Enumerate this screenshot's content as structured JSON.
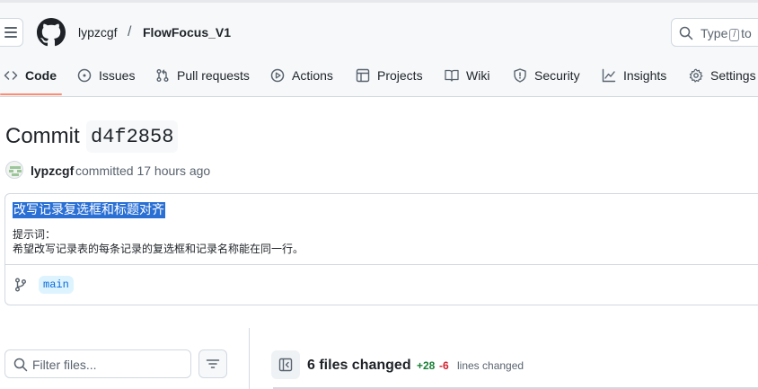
{
  "header": {
    "owner": "lypzcgf",
    "separator": "/",
    "repo": "FlowFocus_V1",
    "search_prefix": "Type",
    "search_key": "/",
    "search_suffix": "to"
  },
  "tabs": [
    {
      "label": "Code",
      "icon": "code-icon",
      "active": true
    },
    {
      "label": "Issues",
      "icon": "issue-opened-icon"
    },
    {
      "label": "Pull requests",
      "icon": "git-pull-request-icon"
    },
    {
      "label": "Actions",
      "icon": "play-icon"
    },
    {
      "label": "Projects",
      "icon": "table-icon"
    },
    {
      "label": "Wiki",
      "icon": "book-icon"
    },
    {
      "label": "Security",
      "icon": "shield-icon"
    },
    {
      "label": "Insights",
      "icon": "graph-icon"
    },
    {
      "label": "Settings",
      "icon": "gear-icon"
    }
  ],
  "commit": {
    "heading": "Commit",
    "sha": "d4f2858",
    "author": "lypzcgf",
    "meta": "committed 17 hours ago",
    "title": "改写记录复选框和标题对齐",
    "body_line1": "提示词：",
    "body_line2": "希望改写记录表的每条记录的复选框和记录名称能在同一行。",
    "branch": "main"
  },
  "files": {
    "filter_placeholder": "Filter files...",
    "changed_label": "6 files changed",
    "additions": "+28",
    "deletions": "-6",
    "lines_label": "lines changed"
  },
  "colors": {
    "accent_tab": "#fd8c73",
    "selection": "#2a6fd4",
    "branch_bg": "#ddf4ff",
    "branch_fg": "#0969da",
    "additions": "#1a7f37",
    "deletions": "#d1242f"
  }
}
